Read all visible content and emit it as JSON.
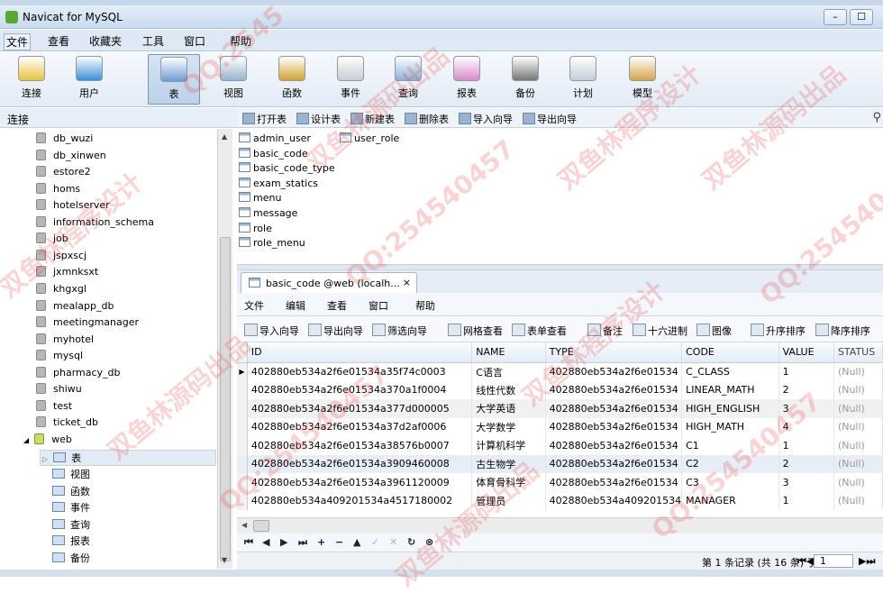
{
  "window": {
    "title": "Navicat for MySQL",
    "background_path": "web/src/com/web/exam/action/ExamStaticsAction.java - MyEclipse Enterprise Workbench"
  },
  "menu": [
    "文件",
    "查看",
    "收藏夹",
    "工具",
    "窗口",
    "帮助"
  ],
  "toolbar": [
    {
      "label": "连接",
      "icon": "connection-icon",
      "color": "#e9c23c"
    },
    {
      "label": "用户",
      "icon": "user-icon",
      "color": "#3b8fd8"
    },
    {
      "label": "表",
      "icon": "table-icon",
      "color": "#6f9bd2",
      "active": true
    },
    {
      "label": "视图",
      "icon": "view-icon",
      "color": "#9bb2cc"
    },
    {
      "label": "函数",
      "icon": "function-icon",
      "color": "#d4a234"
    },
    {
      "label": "事件",
      "icon": "event-icon",
      "color": "#c9ccd2"
    },
    {
      "label": "查询",
      "icon": "query-icon",
      "color": "#8ab0d8"
    },
    {
      "label": "报表",
      "icon": "report-icon",
      "color": "#d98ac7"
    },
    {
      "label": "备份",
      "icon": "backup-icon",
      "color": "#777777"
    },
    {
      "label": "计划",
      "icon": "schedule-icon",
      "color": "#c4cdd8"
    },
    {
      "label": "模型",
      "icon": "model-icon",
      "color": "#d8a24a"
    }
  ],
  "connection_header": "连接",
  "object_toolbar": [
    "打开表",
    "设计表",
    "新建表",
    "删除表",
    "导入向导",
    "导出向导"
  ],
  "tree": {
    "databases": [
      "db_wuzi",
      "db_xinwen",
      "estore2",
      "homs",
      "hotelserver",
      "information_schema",
      "job",
      "jspxscj",
      "jxmnksxt",
      "khgxgl",
      "mealapp_db",
      "meetingmanager",
      "myhotel",
      "mysql",
      "pharmacy_db",
      "shiwu",
      "test",
      "ticket_db"
    ],
    "open_db": "web",
    "open_db_children": [
      "表",
      "视图",
      "函数",
      "事件",
      "查询",
      "报表",
      "备份"
    ]
  },
  "tables_col1": [
    "admin_user",
    "basic_code",
    "basic_code_type",
    "exam_statics",
    "menu",
    "message",
    "role",
    "role_menu"
  ],
  "tables_col2": [
    "user_role"
  ],
  "tab": {
    "label": "basic_code @web (localh...",
    "close": "×"
  },
  "submenu": [
    "文件",
    "编辑",
    "查看",
    "窗口",
    "帮助"
  ],
  "subtoolbar": [
    "导入向导",
    "导出向导",
    "筛选向导",
    "网格查看",
    "表单查看",
    "备注",
    "十六进制",
    "图像",
    "升序排序",
    "降序排序"
  ],
  "grid": {
    "columns": [
      "ID",
      "NAME",
      "TYPE",
      "CODE",
      "VALUE",
      "STATUS"
    ],
    "rows": [
      [
        "402880eb534a2f6e01534a35f74c0003",
        "C语言",
        "402880eb534a2f6e01534",
        "C_CLASS",
        "1",
        "(Null)"
      ],
      [
        "402880eb534a2f6e01534a370a1f0004",
        "线性代数",
        "402880eb534a2f6e01534",
        "LINEAR_MATH",
        "2",
        "(Null)"
      ],
      [
        "402880eb534a2f6e01534a377d000005",
        "大学英语",
        "402880eb534a2f6e01534",
        "HIGH_ENGLISH",
        "3",
        "(Null)"
      ],
      [
        "402880eb534a2f6e01534a37d2af0006",
        "大学数学",
        "402880eb534a2f6e01534",
        "HIGH_MATH",
        "4",
        "(Null)"
      ],
      [
        "402880eb534a2f6e01534a38576b0007",
        "计算机科学",
        "402880eb534a2f6e01534",
        "C1",
        "1",
        "(Null)"
      ],
      [
        "402880eb534a2f6e01534a3909460008",
        "古生物学",
        "402880eb534a2f6e01534",
        "C2",
        "2",
        "(Null)"
      ],
      [
        "402880eb534a2f6e01534a3961120009",
        "体育骨科学",
        "402880eb534a2f6e01534",
        "C3",
        "3",
        "(Null)"
      ],
      [
        "402880eb534a409201534a4517180002",
        "管理员",
        "402880eb534a409201534",
        "MANAGER",
        "1",
        "(Null)"
      ]
    ]
  },
  "nav_buttons": [
    "⏮",
    "◀",
    "▶",
    "⏭",
    "+",
    "−",
    "▲",
    "✓",
    "✕",
    "↻",
    "⊗"
  ],
  "status": {
    "text": "第 1 条记录 (共 16 条) 于 1 页",
    "page": "1"
  },
  "watermarks": [
    "QQ:2545",
    "双鱼林源码出品",
    "QQ:254540457",
    "双鱼林程序设计"
  ]
}
